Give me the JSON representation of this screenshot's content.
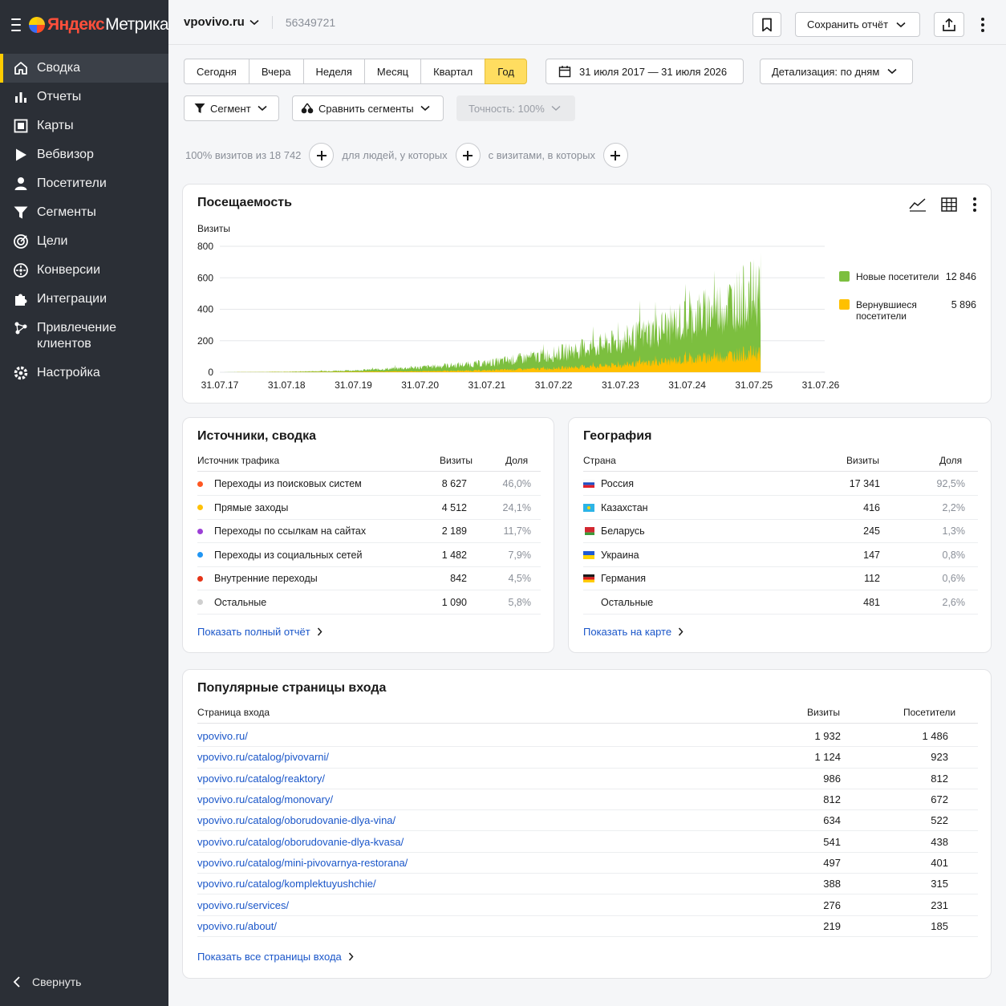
{
  "sidebar": {
    "logo_ya": "Яндекс",
    "logo_m": "Метрика",
    "items": [
      {
        "label": "Сводка",
        "icon": "home-icon",
        "active": true
      },
      {
        "label": "Отчеты",
        "icon": "bar-chart-icon"
      },
      {
        "label": "Карты",
        "icon": "map-icon"
      },
      {
        "label": "Вебвизор",
        "icon": "play-icon"
      },
      {
        "label": "Посетители",
        "icon": "user-icon"
      },
      {
        "label": "Сегменты",
        "icon": "filter-icon"
      },
      {
        "label": "Цели",
        "icon": "target-icon"
      },
      {
        "label": "Конверсии",
        "icon": "conversion-icon"
      },
      {
        "label": "Интеграции",
        "icon": "puzzle-icon"
      },
      {
        "label": "Привлечение\nклиентов",
        "icon": "nodes-icon"
      },
      {
        "label": "Настройка",
        "icon": "gear-icon"
      }
    ],
    "collapse_label": "Свернуть"
  },
  "topbar": {
    "site": "vpovivo.ru",
    "counter_id": "56349721",
    "save_label": "Сохранить отчёт"
  },
  "periods": [
    "Сегодня",
    "Вчера",
    "Неделя",
    "Месяц",
    "Квартал",
    "Год"
  ],
  "active_period": "Год",
  "date_range": "31 июля 2017 — 31 июля 2026",
  "detail_label": "Детализация: по дням",
  "segment_label": "Сегмент",
  "compare_label": "Сравнить сегменты",
  "accuracy_label": "Точность: 100%",
  "filters": {
    "visits_text": "100% визитов из 18 742",
    "people_text": "для людей, у которых",
    "visits_cond_text": "с визитами, в которых"
  },
  "attendance": {
    "title": "Посещаемость",
    "legend": [
      {
        "name": "Новые посетители",
        "value": "12 846",
        "color": "#7cbf3f"
      },
      {
        "name": "Вернувшиеся\nпосетители",
        "value": "5 896",
        "color": "#ffc000"
      }
    ]
  },
  "chart_data": {
    "type": "area",
    "title": "Посещаемость",
    "ylabel": "Визиты",
    "xlabel": "",
    "ylim": [
      0,
      800
    ],
    "yticks": [
      0,
      200,
      400,
      600,
      800
    ],
    "x": [
      "31.07.17",
      "31.07.18",
      "31.07.19",
      "31.07.20",
      "31.07.21",
      "31.07.22",
      "31.07.23",
      "31.07.24",
      "31.07.25",
      "31.07.26"
    ],
    "stacked": true,
    "grid": true,
    "legend": "right",
    "series": [
      {
        "name": "Новые посетители",
        "color": "#7cbf3f",
        "values": [
          0,
          2,
          8,
          25,
          45,
          90,
          150,
          250,
          380,
          600
        ]
      },
      {
        "name": "Вернувшиеся посетители",
        "color": "#ffc000",
        "values": [
          0,
          1,
          3,
          6,
          12,
          25,
          45,
          80,
          120,
          180
        ]
      }
    ]
  },
  "sources": {
    "title": "Источники, сводка",
    "col_name": "Источник трафика",
    "col_visits": "Визиты",
    "col_share": "Доля",
    "rows": [
      {
        "name": "Переходы из поисковых систем",
        "visits": "8 627",
        "share": "46,0%",
        "color": "#ff5722"
      },
      {
        "name": "Прямые заходы",
        "visits": "4 512",
        "share": "24,1%",
        "color": "#ffc107"
      },
      {
        "name": "Переходы по ссылкам на сайтах",
        "visits": "2 189",
        "share": "11,7%",
        "color": "#9c3fd6"
      },
      {
        "name": "Переходы из социальных сетей",
        "visits": "1 482",
        "share": "7,9%",
        "color": "#2196f3"
      },
      {
        "name": "Внутренние переходы",
        "visits": "842",
        "share": "4,5%",
        "color": "#e53418"
      },
      {
        "name": "Остальные",
        "visits": "1 090",
        "share": "5,8%",
        "color": "#cfcfcf"
      }
    ],
    "more": "Показать полный отчёт"
  },
  "geo": {
    "title": "География",
    "col_name": "Страна",
    "col_visits": "Визиты",
    "col_share": "Доля",
    "rows": [
      {
        "name": "Россия",
        "visits": "17 341",
        "share": "92,5%",
        "flag": "ru"
      },
      {
        "name": "Казахстан",
        "visits": "416",
        "share": "2,2%",
        "flag": "kz"
      },
      {
        "name": "Беларусь",
        "visits": "245",
        "share": "1,3%",
        "flag": "by"
      },
      {
        "name": "Украина",
        "visits": "147",
        "share": "0,8%",
        "flag": "ua"
      },
      {
        "name": "Германия",
        "visits": "112",
        "share": "0,6%",
        "flag": "de"
      },
      {
        "name": "Остальные",
        "visits": "481",
        "share": "2,6%",
        "flag": ""
      }
    ],
    "more": "Показать на карте"
  },
  "pages": {
    "title": "Популярные страницы входа",
    "col_name": "Страница входа",
    "col_visits": "Визиты",
    "col_visitors": "Посетители",
    "rows": [
      {
        "url": "vpovivo.ru/",
        "visits": "1 932",
        "visitors": "1 486"
      },
      {
        "url": "vpovivo.ru/catalog/pivovarni/",
        "visits": "1 124",
        "visitors": "923"
      },
      {
        "url": "vpovivo.ru/catalog/reaktory/",
        "visits": "986",
        "visitors": "812"
      },
      {
        "url": "vpovivo.ru/catalog/monovary/",
        "visits": "812",
        "visitors": "672"
      },
      {
        "url": "vpovivo.ru/catalog/oborudovanie-dlya-vina/",
        "visits": "634",
        "visitors": "522"
      },
      {
        "url": "vpovivo.ru/catalog/oborudovanie-dlya-kvasa/",
        "visits": "541",
        "visitors": "438"
      },
      {
        "url": "vpovivo.ru/catalog/mini-pivovarnya-restorana/",
        "visits": "497",
        "visitors": "401"
      },
      {
        "url": "vpovivo.ru/catalog/komplektuyushchie/",
        "visits": "388",
        "visitors": "315"
      },
      {
        "url": "vpovivo.ru/services/",
        "visits": "276",
        "visitors": "231"
      },
      {
        "url": "vpovivo.ru/about/",
        "visits": "219",
        "visitors": "185"
      }
    ],
    "more": "Показать все страницы входа"
  }
}
